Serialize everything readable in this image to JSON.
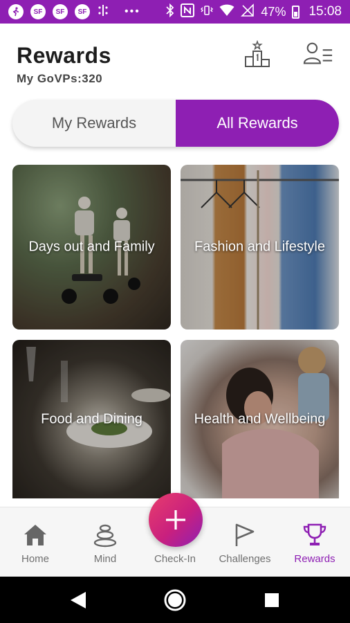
{
  "status_bar": {
    "icons": [
      "walk-icon",
      "sf-icon",
      "sf-icon",
      "sf-icon",
      "fitness-icon",
      "more-dots-icon",
      "bluetooth-icon",
      "nfc-icon",
      "vibrate-icon",
      "wifi-icon",
      "no-signal-icon",
      "battery-icon"
    ],
    "sf_text": "SF",
    "dots": "•••",
    "battery": "47%",
    "time": "15:08"
  },
  "header": {
    "title": "Rewards",
    "points_text": "My GoVPs:320",
    "icons": [
      "podium-icon",
      "profile-list-icon"
    ]
  },
  "toggle": {
    "my_rewards": "My Rewards",
    "all_rewards": "All Rewards",
    "active": "all_rewards"
  },
  "categories": [
    {
      "label": "Days out and Family"
    },
    {
      "label": "Fashion and Lifestyle"
    },
    {
      "label": "Food and Dining"
    },
    {
      "label": "Health and Wellbeing"
    }
  ],
  "bottom_nav": {
    "items": [
      {
        "label": "Home",
        "icon": "home-icon"
      },
      {
        "label": "Mind",
        "icon": "stones-icon"
      },
      {
        "label": "Check-In",
        "icon": "plus-icon"
      },
      {
        "label": "Challenges",
        "icon": "flag-icon"
      },
      {
        "label": "Rewards",
        "icon": "trophy-icon"
      }
    ],
    "active": "Rewards"
  },
  "colors": {
    "brand": "#8e1fb3",
    "fab_start": "#e83e6c",
    "fab_end": "#8e1fb3",
    "inactive_text": "#6f6f6f"
  },
  "system_nav": {
    "icons": [
      "back-icon",
      "home-circle-icon",
      "recents-icon"
    ]
  }
}
